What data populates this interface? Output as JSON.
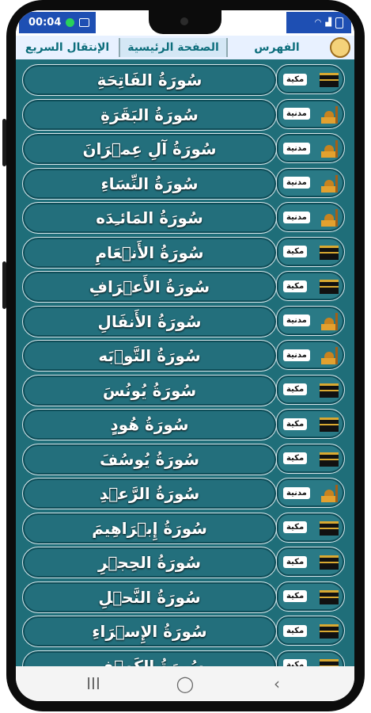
{
  "status": {
    "time": "00:04",
    "left_icons": [
      "whatsapp-icon",
      "gallery-icon"
    ],
    "right_icons": [
      "wifi-icon",
      "signal-icon",
      "battery-icon"
    ]
  },
  "tabs": [
    {
      "label": "الفهرس",
      "active": false
    },
    {
      "label": "الصفحة الرئيسية",
      "active": true
    },
    {
      "label": "الإنتقال السريع",
      "active": false
    }
  ],
  "surahs": [
    {
      "name": "سُورَةُ الفَاتِحَةِ",
      "type": "مكية",
      "icon": "kaaba-icon"
    },
    {
      "name": "سُورَةُ البَقَرَةِ",
      "type": "مدنية",
      "icon": "mosque-icon"
    },
    {
      "name": "سُورَةُ آلِ عِمۡرَانَ",
      "type": "مدنية",
      "icon": "mosque-icon"
    },
    {
      "name": "سُورَةُ النِّسَاءِ",
      "type": "مدنية",
      "icon": "mosque-icon"
    },
    {
      "name": "سُورَةُ المَائـِدَه",
      "type": "مدنية",
      "icon": "mosque-icon"
    },
    {
      "name": "سُورَةُ الأَنۡعَامِ",
      "type": "مكية",
      "icon": "kaaba-icon"
    },
    {
      "name": "سُورَةُ الأَعۡرَافِ",
      "type": "مكية",
      "icon": "kaaba-icon"
    },
    {
      "name": "سُورَةُ الأَنفَالِ",
      "type": "مدنية",
      "icon": "mosque-icon"
    },
    {
      "name": "سُورَةُ التَّوۡبَه",
      "type": "مدنية",
      "icon": "mosque-icon"
    },
    {
      "name": "سُورَةُ يُونُسَ",
      "type": "مكية",
      "icon": "kaaba-icon"
    },
    {
      "name": "سُورَةُ هُودٍ",
      "type": "مكية",
      "icon": "kaaba-icon"
    },
    {
      "name": "سُورَةُ يُوسُفَ",
      "type": "مكية",
      "icon": "kaaba-icon"
    },
    {
      "name": "سُورَةُ الرَّعۡدِ",
      "type": "مدنية",
      "icon": "mosque-icon"
    },
    {
      "name": "سُورَةُ إِبۡرَاهِيمَ",
      "type": "مكية",
      "icon": "kaaba-icon"
    },
    {
      "name": "سُورَةُ الحِجۡرِ",
      "type": "مكية",
      "icon": "kaaba-icon"
    },
    {
      "name": "سُورَةُ النَّحۡلِ",
      "type": "مكية",
      "icon": "kaaba-icon"
    },
    {
      "name": "سُورَةُ الإِسۡرَاءِ",
      "type": "مكية",
      "icon": "kaaba-icon"
    },
    {
      "name": "سُورَةُ الكَهۡفِ",
      "type": "مكية",
      "icon": "kaaba-icon"
    }
  ],
  "nav": {
    "recent": "III",
    "home": "◯",
    "back": "‹"
  }
}
